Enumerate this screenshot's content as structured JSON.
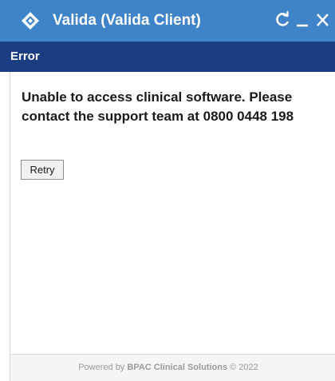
{
  "window": {
    "title": "Valida (Valida Client)",
    "logo_icon": "valida-logo-icon",
    "controls": {
      "refresh_icon": "refresh-icon",
      "minimize_icon": "minimize-icon",
      "close_icon": "close-icon"
    }
  },
  "error_header": {
    "label": "Error"
  },
  "message": {
    "text": "Unable to access clinical software. Please contact the support team at 0800 0448 198"
  },
  "retry_button": {
    "label": "Retry"
  },
  "footer": {
    "prefix": "Powered by ",
    "brand": "BPAC Clinical Solutions",
    "suffix": " © 2022"
  },
  "colors": {
    "titlebar": "#3f83c9",
    "error_header": "#1b3d82",
    "footer_text": "#9a9a9a"
  }
}
